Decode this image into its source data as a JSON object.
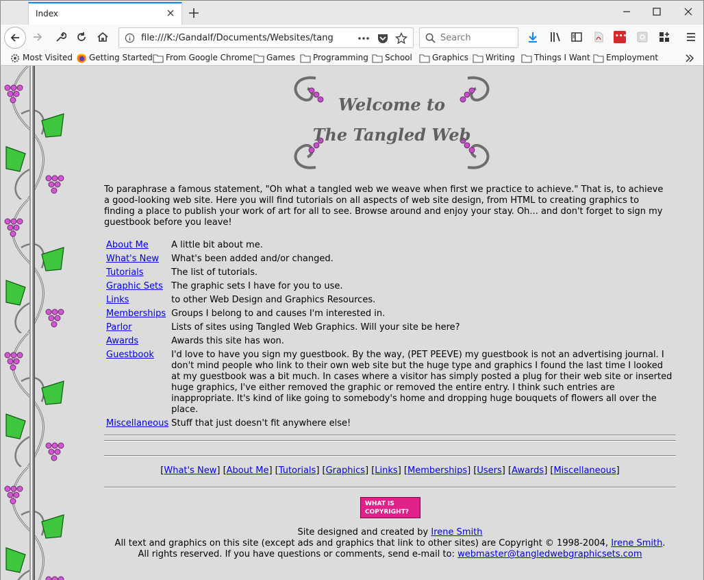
{
  "browser": {
    "tab_title": "Index",
    "url": "file:///K:/Gandalf/Documents/Websites/tangle",
    "search_placeholder": "Search",
    "bookmarks": [
      {
        "label": "Most Visited",
        "icon": "gear-icon"
      },
      {
        "label": "Getting Started",
        "icon": "firefox-icon"
      },
      {
        "label": "From Google Chrome",
        "icon": "folder-icon"
      },
      {
        "label": "Games",
        "icon": "folder-icon"
      },
      {
        "label": "Programming",
        "icon": "folder-icon"
      },
      {
        "label": "School",
        "icon": "folder-icon"
      },
      {
        "label": "Graphics",
        "icon": "folder-icon"
      },
      {
        "label": "Writing",
        "icon": "folder-icon"
      },
      {
        "label": "Things I Want",
        "icon": "folder-icon"
      },
      {
        "label": "Employment",
        "icon": "folder-icon"
      }
    ]
  },
  "page": {
    "banner_line1": "Welcome to",
    "banner_line2": "The Tangled Web",
    "intro": "To paraphrase a famous statement, \"Oh what a tangled web we weave when first we practice to achieve.\" That is, to achieve a good-looking web site. Here you will find tutorials on all aspects of web site design, from HTML to creating graphics to finding a place to publish your work of art for all to see. Browse around and enjoy your stay. Oh... and don't forget to sign my guestbook before you leave!",
    "links": [
      {
        "label": "About Me",
        "desc": "A little bit about me."
      },
      {
        "label": "What's New",
        "desc": "What's been added and/or changed."
      },
      {
        "label": "Tutorials",
        "desc": "The list of tutorials."
      },
      {
        "label": "Graphic Sets",
        "desc": "The graphic sets I have for you to use."
      },
      {
        "label": "Links",
        "desc": "to other Web Design and Graphics Resources."
      },
      {
        "label": "Memberships",
        "desc": "Groups I belong to and causes I'm interested in."
      },
      {
        "label": "Parlor",
        "desc": "Lists of sites using Tangled Web Graphics. Will your site be here?"
      },
      {
        "label": "Awards",
        "desc": "Awards this site has won."
      },
      {
        "label": "Guestbook",
        "desc": "I'd love to have you sign my guestbook. By the way, (PET PEEVE) my guestbook is not an advertising journal. I don't mind people who link to their own web site but the huge type and graphics I found the last time I looked at my guestbook was a bit much. In cases where a visitor has simply posted a plug for their web site or inserted huge graphics, I've either removed the graphic or removed the entire entry. I think such entries are inappropriate. It's kind of like going to somebody's home and dropping huge bouquets of flowers all over the place."
      },
      {
        "label": "Miscellaneous",
        "desc": "Stuff that just doesn't fit anywhere else!"
      }
    ],
    "nav_links": [
      "What's New",
      "About Me",
      "Tutorials",
      "Graphics",
      "Links",
      "Memberships",
      "Users",
      "Awards",
      "Miscellaneous"
    ],
    "copyright_button": [
      "WHAT IS",
      "COPYRIGHT?"
    ],
    "footer": {
      "designed_prefix": "Site designed and created by",
      "author": "Irene Smith",
      "copyright_text": "All text and graphics on this site (except ads and graphics that link to other sites) are Copyright © 1998-2004,",
      "reserved_text": "All rights reserved. If you have questions or comments, send e-mail to:",
      "email": "webmaster@tangledwebgraphicsets.com"
    }
  }
}
